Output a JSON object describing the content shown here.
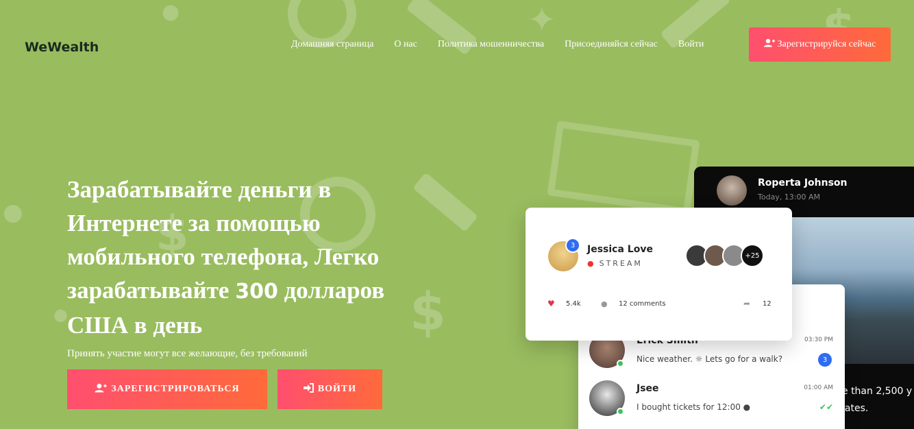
{
  "header": {
    "logo": "WeWealth",
    "nav": [
      "Домашняя страница",
      "О нас",
      "Политика мошенничества",
      "Присоединяйся сейчас",
      "Войти"
    ],
    "register_button": "Зарегистрируйся сейчас"
  },
  "hero": {
    "title_part1": "Зарабатывайте деньги в Интернете за помощью мобильного телефона, Легко зарабатывайте",
    "title_number": "300",
    "title_part2": "долларов США в день",
    "subtitle": "Принять участие могут все желающие, без требований",
    "register_cta": "ЗАРЕГИСТРИРОВАТЬСЯ",
    "login_cta": "ВОЙТИ"
  },
  "mockups": {
    "dark_card": {
      "name": "Roperta Johnson",
      "time": "Today, 13:00 AM",
      "caption_line1": "e than 2,500 y",
      "caption_line2": "lates."
    },
    "post_card": {
      "name": "Jessica Love",
      "label": "STREAM",
      "badge": "3",
      "viewers_extra": "+25",
      "likes": "5.4k",
      "comments": "12 comments",
      "shares": "12"
    },
    "chat_card": {
      "rows": [
        {
          "name": "Erick Smith",
          "message": "Nice weather. ☼ Lets go for a walk?",
          "time": "03:30 PM",
          "badge": "3"
        },
        {
          "name": "Jsee",
          "message": "I bought tickets for 12:00 ●",
          "time": "01:00 AM"
        }
      ]
    }
  },
  "icons": {
    "user_plus": "user-plus-icon",
    "sign_in": "sign-in-icon",
    "heart": "heart-icon",
    "comment": "comment-icon",
    "share": "share-icon"
  }
}
